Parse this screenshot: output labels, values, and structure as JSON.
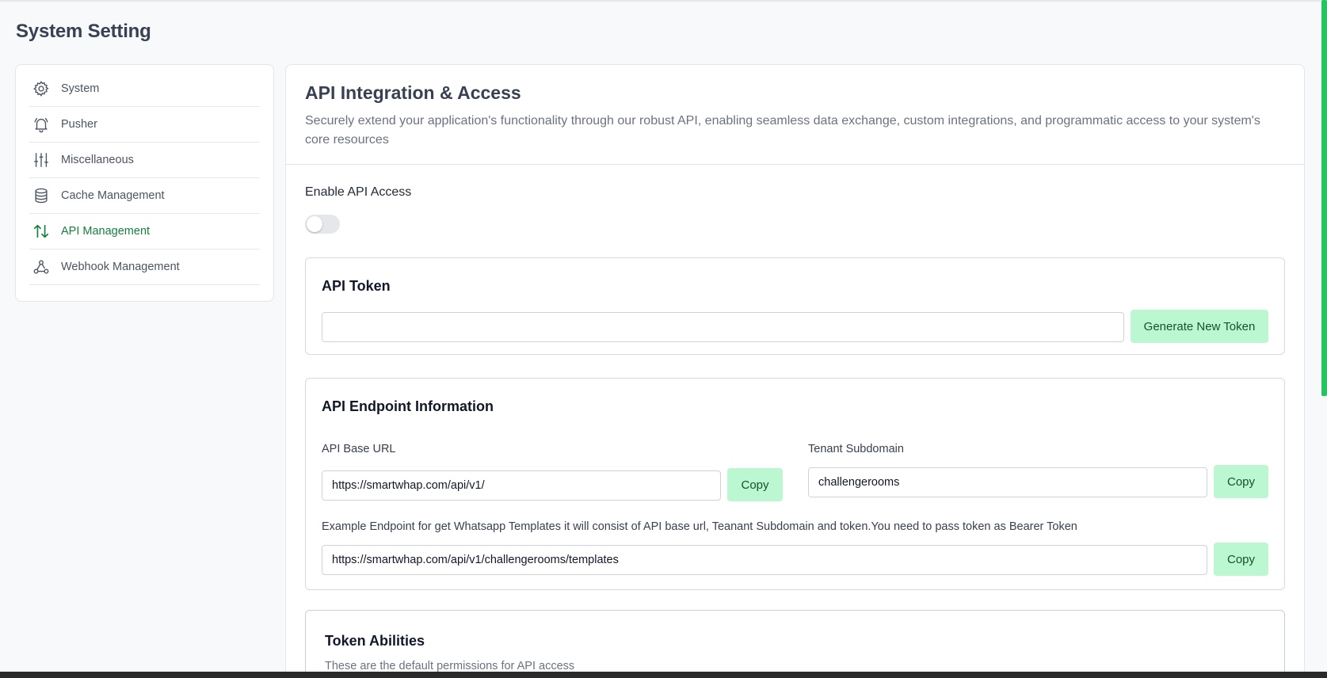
{
  "page": {
    "title": "System Setting"
  },
  "sidebar": {
    "items": [
      {
        "label": "System",
        "icon": "gear-icon",
        "active": false
      },
      {
        "label": "Pusher",
        "icon": "bell-icon",
        "active": false
      },
      {
        "label": "Miscellaneous",
        "icon": "sliders-icon",
        "active": false
      },
      {
        "label": "Cache Management",
        "icon": "database-icon",
        "active": false
      },
      {
        "label": "API Management",
        "icon": "arrows-up-down-icon",
        "active": true
      },
      {
        "label": "Webhook Management",
        "icon": "webhook-icon",
        "active": false
      }
    ]
  },
  "main": {
    "title": "API Integration & Access",
    "description": "Securely extend your application's functionality through our robust API, enabling seamless data exchange, custom integrations, and programmatic access to your system's core resources",
    "enable_label": "Enable API Access",
    "enable_value": false
  },
  "token_card": {
    "title": "API Token",
    "token_value": "",
    "generate_label": "Generate New Token"
  },
  "endpoint_card": {
    "title": "API Endpoint Information",
    "base_url_label": "API Base URL",
    "base_url_value": "https://smartwhap.com/api/v1/",
    "tenant_label": "Tenant Subdomain",
    "tenant_value": "challengerooms",
    "example_label": "Example Endpoint for get Whatsapp Templates it will consist of API base url, Teanant Subdomain and token.You need to pass token as Bearer Token",
    "example_value": "https://smartwhap.com/api/v1/challengerooms/templates",
    "copy_label": "Copy"
  },
  "abilities_card": {
    "title": "Token Abilities",
    "description": "These are the default permissions for API access"
  },
  "colors": {
    "accent": "#15803d",
    "button_bg": "#bbf7d0",
    "scrollbar": "#22c55e"
  }
}
